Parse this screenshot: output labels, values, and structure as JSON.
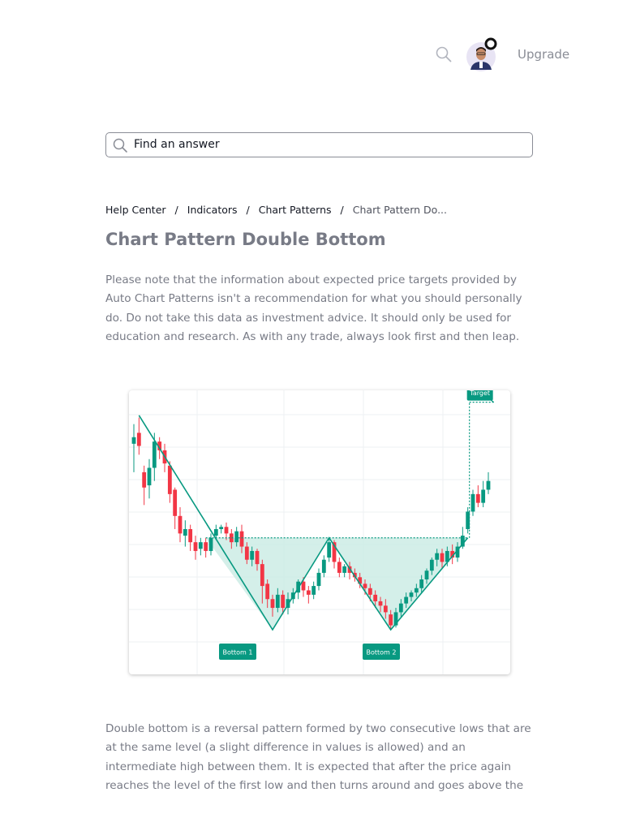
{
  "header": {
    "search_icon": "search-icon",
    "avatar_icon": "user-avatar",
    "upgrade_label": "Upgrade"
  },
  "search": {
    "placeholder": "Find an answer"
  },
  "breadcrumb": {
    "items": [
      "Help Center",
      "Indicators",
      "Chart Patterns",
      "Chart Pattern Do..."
    ],
    "separator": "/"
  },
  "article": {
    "title": "Chart Pattern Double Bottom",
    "paragraph1": "Please note that the information about expected price targets provided by Auto Chart Patterns isn't a recommendation for what you should personally do. Do not take this data as investment advice. It should only be used for education and research. As with any trade, always look first and then leap.",
    "paragraph2": "Double bottom is a reversal pattern formed by two consecutive lows that are at the same level (a slight difference in values is allowed) and an intermediate high between them. It is expected that after the price again reaches the level of the first low and then turns around and goes above the"
  },
  "chart_data": {
    "type": "candlestick",
    "labels": {
      "bottom1": "Bottom 1",
      "bottom2": "Bottom 2",
      "target": "Target"
    },
    "colors": {
      "up": "#089981",
      "down": "#f23645",
      "pattern": "#089981",
      "pattern_fill": "#c9ebe3"
    },
    "grid": true,
    "candles": [
      [
        83,
        86,
        70,
        92
      ],
      [
        88,
        82,
        78,
        95
      ],
      [
        70,
        63,
        55,
        73
      ],
      [
        64,
        72,
        58,
        76
      ],
      [
        72,
        84,
        66,
        88
      ],
      [
        84,
        80,
        76,
        86
      ],
      [
        80,
        74,
        70,
        83
      ],
      [
        73,
        60,
        56,
        75
      ],
      [
        62,
        50,
        44,
        63
      ],
      [
        50,
        42,
        38,
        54
      ],
      [
        41,
        44,
        36,
        48
      ],
      [
        44,
        38,
        34,
        46
      ],
      [
        38,
        34,
        30,
        41
      ],
      [
        35,
        38,
        32,
        40
      ],
      [
        38,
        34,
        31,
        40
      ],
      [
        34,
        40,
        32,
        42
      ],
      [
        41,
        44,
        39,
        46
      ],
      [
        44,
        45,
        42,
        46
      ],
      [
        45,
        42,
        39,
        47
      ],
      [
        42,
        38,
        35,
        44
      ],
      [
        38,
        43,
        36,
        45
      ],
      [
        43,
        36,
        33,
        46
      ],
      [
        36,
        30,
        28,
        38
      ],
      [
        30,
        34,
        27,
        36
      ],
      [
        34,
        28,
        25,
        35
      ],
      [
        28,
        18,
        10,
        30
      ],
      [
        19,
        12,
        8,
        21
      ],
      [
        12,
        8,
        4,
        14
      ],
      [
        8,
        14,
        6,
        17
      ],
      [
        14,
        8,
        5,
        16
      ],
      [
        8,
        12,
        5,
        15
      ],
      [
        12,
        15,
        10,
        17
      ],
      [
        15,
        20,
        12,
        21
      ],
      [
        20,
        16,
        13,
        22
      ],
      [
        16,
        14,
        10,
        18
      ],
      [
        14,
        18,
        12,
        20
      ],
      [
        18,
        24,
        16,
        26
      ],
      [
        24,
        30,
        22,
        32
      ],
      [
        31,
        38,
        29,
        40
      ],
      [
        38,
        29,
        26,
        39
      ],
      [
        29,
        24,
        22,
        31
      ],
      [
        24,
        27,
        22,
        28
      ],
      [
        27,
        24,
        21,
        29
      ],
      [
        24,
        22,
        20,
        26
      ],
      [
        22,
        19,
        17,
        24
      ],
      [
        19,
        17,
        14,
        21
      ],
      [
        17,
        14,
        11,
        19
      ],
      [
        14,
        11,
        8,
        16
      ],
      [
        11,
        9,
        6,
        13
      ],
      [
        9,
        6,
        3,
        12
      ],
      [
        5,
        0,
        -2,
        7
      ],
      [
        0,
        6,
        -1,
        8
      ],
      [
        6,
        10,
        4,
        12
      ],
      [
        10,
        13,
        8,
        15
      ],
      [
        13,
        15,
        11,
        16
      ],
      [
        15,
        17,
        13,
        19
      ],
      [
        17,
        21,
        15,
        23
      ],
      [
        21,
        25,
        19,
        26
      ],
      [
        25,
        30,
        23,
        31
      ],
      [
        30,
        33,
        27,
        35
      ],
      [
        33,
        29,
        26,
        35
      ],
      [
        29,
        34,
        27,
        36
      ],
      [
        34,
        31,
        28,
        37
      ],
      [
        31,
        36,
        29,
        38
      ],
      [
        36,
        41,
        35,
        45
      ],
      [
        44,
        52,
        42,
        54
      ],
      [
        52,
        60,
        50,
        62
      ],
      [
        60,
        56,
        54,
        64
      ],
      [
        56,
        62,
        54,
        66
      ],
      [
        62,
        66,
        60,
        70
      ]
    ]
  }
}
